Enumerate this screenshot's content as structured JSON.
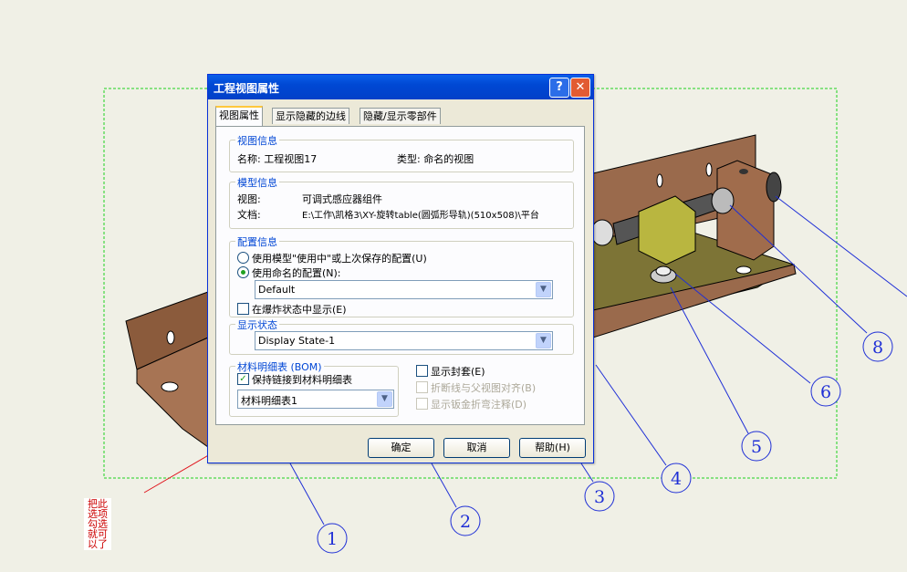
{
  "dialog": {
    "title": "工程视图属性",
    "help_glyph": "?",
    "close_glyph": "✕",
    "tabs": [
      {
        "label": "视图属性"
      },
      {
        "label": "显示隐藏的边线"
      },
      {
        "label": "隐藏/显示零部件"
      }
    ],
    "view_info": {
      "label": "视图信息",
      "name": "名称: 工程视图17",
      "type": "类型: 命名的视图"
    },
    "model_info": {
      "label": "模型信息",
      "view_label": "视图:",
      "view_value": "可调式感应器组件",
      "doc_label": "文档:",
      "doc_value": "E:\\工作\\凯格3\\XY-旋转table(圆弧形导轨)(510x508)\\平台"
    },
    "config_info": {
      "label": "配置信息",
      "option1": "使用模型\"使用中\"或上次保存的配置(U)",
      "option2": "使用命名的配置(N):",
      "selected": "option2",
      "config_value": "Default",
      "exploded": "在爆炸状态中显示(E)",
      "exploded_checked": false
    },
    "display_state": {
      "label": "显示状态",
      "value": "Display State-1"
    },
    "bom": {
      "label": "材料明细表 (BOM)",
      "keep_link": "保持链接到材料明细表",
      "keep_link_checked": true,
      "value": "材料明细表1"
    },
    "options": {
      "show_envelope": "显示封套(E)",
      "align_break": "折断线与父视图对齐(B)",
      "show_sheetmetal": "显示钣金折弯注释(D)"
    },
    "buttons": {
      "ok": "确定",
      "cancel": "取消",
      "help": "帮助(H)"
    }
  },
  "balloons": [
    "1",
    "2",
    "3",
    "4",
    "5",
    "6",
    "8"
  ],
  "annotation_note": "把此选项勾选就可以了",
  "colors": {
    "part": "#9a6a4c",
    "base": "#7d7436",
    "block": "#b9b640",
    "balloon": "#1f2fd6",
    "frame": "#1ed21e",
    "annotation": "#e0141c"
  }
}
